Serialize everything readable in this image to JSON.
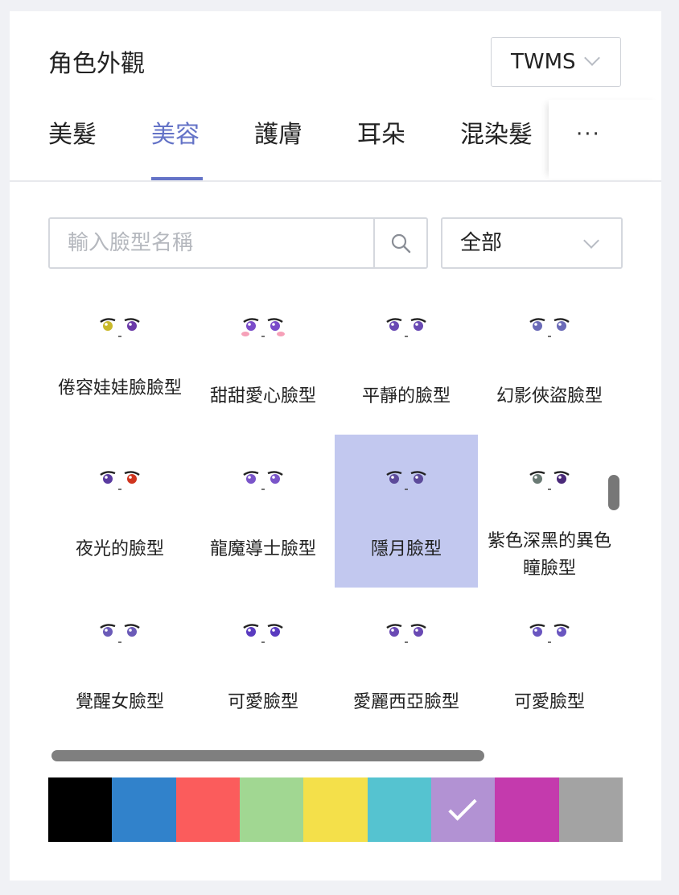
{
  "header": {
    "title": "角色外觀",
    "region": "TWMS"
  },
  "tabs": [
    {
      "label": "美髮",
      "active": false
    },
    {
      "label": "美容",
      "active": true
    },
    {
      "label": "護膚",
      "active": false
    },
    {
      "label": "耳朵",
      "active": false
    },
    {
      "label": "混染髮",
      "active": false
    }
  ],
  "tabs_more": "···",
  "search": {
    "placeholder": "輸入臉型名稱",
    "value": ""
  },
  "filter": {
    "selected": "全部"
  },
  "faces": [
    {
      "label": "倦容娃娃臉臉型",
      "eye_left": "#c9b92a",
      "eye_right": "#6b3aa8",
      "blush": false,
      "selected": false
    },
    {
      "label": "甜甜愛心臉型",
      "eye_left": "#7a4cc9",
      "eye_right": "#7a4cc9",
      "blush": true,
      "selected": false
    },
    {
      "label": "平靜的臉型",
      "eye_left": "#6a4ab4",
      "eye_right": "#6a4ab4",
      "blush": false,
      "selected": false
    },
    {
      "label": "幻影俠盜臉型",
      "eye_left": "#6b6bb8",
      "eye_right": "#6b6bb8",
      "blush": false,
      "selected": false
    },
    {
      "label": "夜光的臉型",
      "eye_left": "#5a3ba0",
      "eye_right": "#d0351f",
      "blush": false,
      "selected": false
    },
    {
      "label": "龍魔導士臉型",
      "eye_left": "#7a55c9",
      "eye_right": "#7a55c9",
      "blush": false,
      "selected": false
    },
    {
      "label": "隱月臉型",
      "eye_left": "#5c4a9a",
      "eye_right": "#5c4a9a",
      "blush": false,
      "selected": true
    },
    {
      "label": "紫色深黑的異色瞳臉型",
      "eye_left": "#6a7a74",
      "eye_right": "#4b2a7a",
      "blush": false,
      "selected": false
    },
    {
      "label": "覺醒女臉型",
      "eye_left": "#6b5bb8",
      "eye_right": "#6b5bb8",
      "blush": false,
      "selected": false
    },
    {
      "label": "可愛臉型",
      "eye_left": "#5a3bc0",
      "eye_right": "#5a3bc0",
      "blush": false,
      "selected": false
    },
    {
      "label": "愛麗西亞臉型",
      "eye_left": "#6a4ab4",
      "eye_right": "#6a4ab4",
      "blush": false,
      "selected": false
    },
    {
      "label": "可愛臉型",
      "eye_left": "#6a56c0",
      "eye_right": "#6a56c0",
      "blush": false,
      "selected": false
    }
  ],
  "colors": [
    {
      "name": "black",
      "hex": "#000000",
      "selected": false
    },
    {
      "name": "blue",
      "hex": "#3182cb",
      "selected": false
    },
    {
      "name": "red",
      "hex": "#fb5c5c",
      "selected": false
    },
    {
      "name": "green",
      "hex": "#a1d792",
      "selected": false
    },
    {
      "name": "yellow",
      "hex": "#f4e04a",
      "selected": false
    },
    {
      "name": "cyan",
      "hex": "#55c3d0",
      "selected": false
    },
    {
      "name": "purple",
      "hex": "#b292d3",
      "selected": true
    },
    {
      "name": "magenta",
      "hex": "#c43aad",
      "selected": false
    },
    {
      "name": "gray",
      "hex": "#a3a3a3",
      "selected": false
    }
  ],
  "accent": "#6473c7"
}
